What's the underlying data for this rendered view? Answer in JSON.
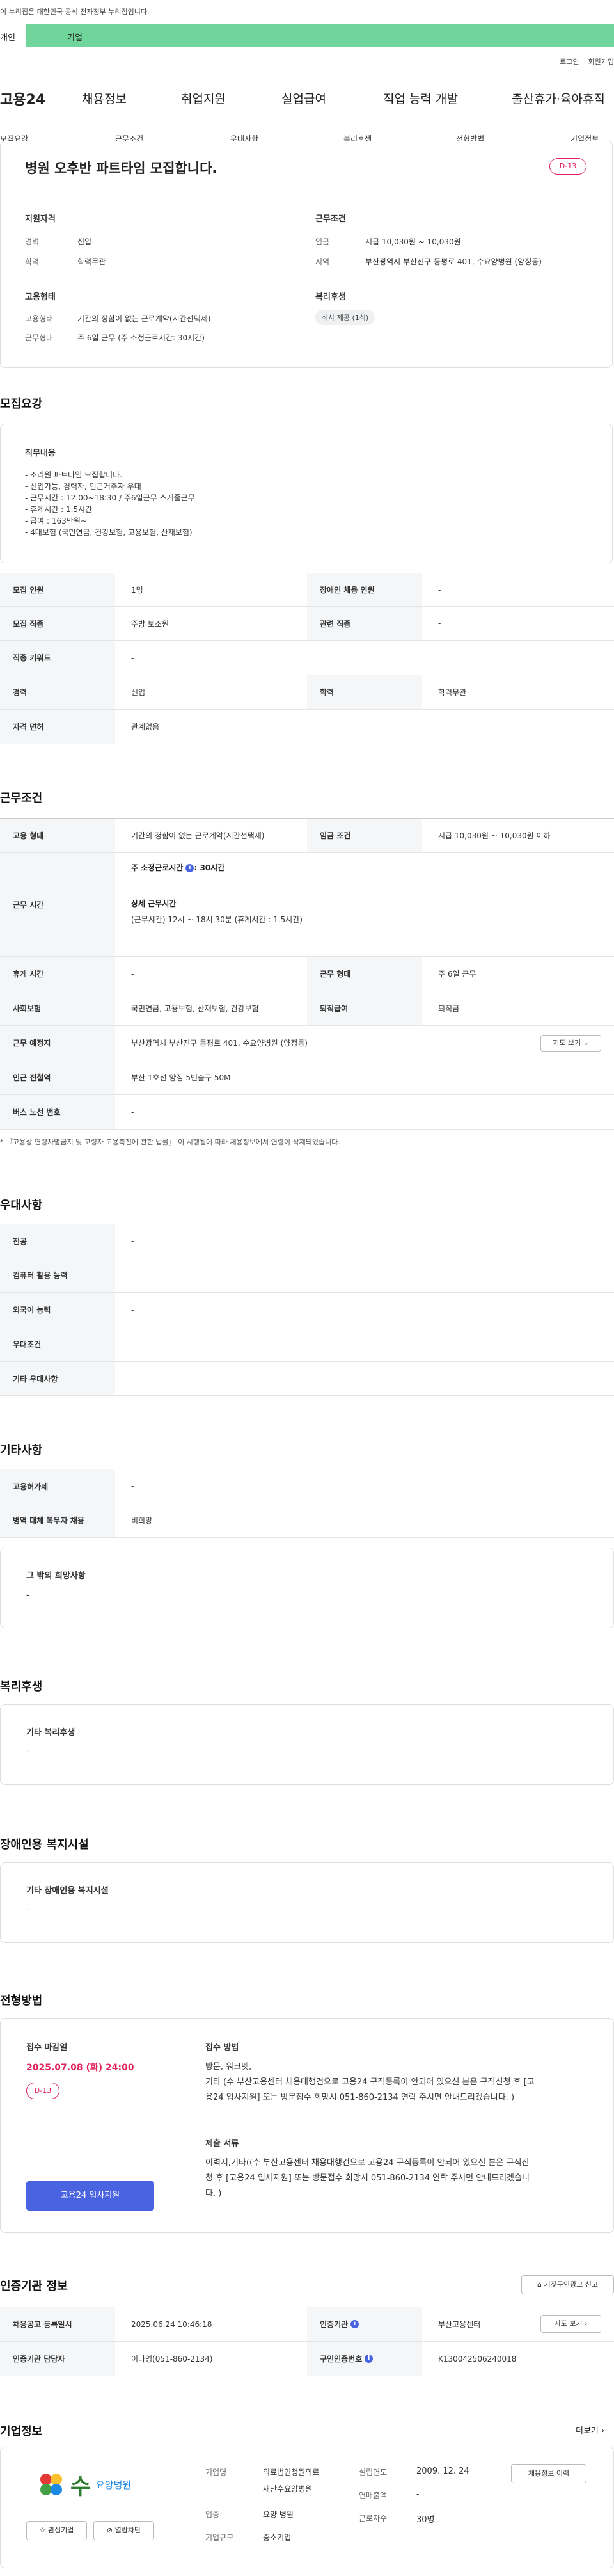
{
  "gov_banner": "이 누리집은 대한민국 공식 전자정부 누리집입니다.",
  "tabs": {
    "personal": "개인",
    "business": "기업"
  },
  "util": {
    "login": "로그인",
    "signup": "회원가입"
  },
  "nav": {
    "logo": "고용24",
    "items": [
      "채용정보",
      "취업지원",
      "실업급여",
      "직업 능력 개발",
      "출산휴가·육아휴직"
    ]
  },
  "subnav": [
    "모집요강",
    "근무조건",
    "우대사항",
    "복리후생",
    "전형방법",
    "기업정보"
  ],
  "summary": {
    "title": "병원 오후반 파트타임 모집합니다.",
    "dday": "D-13",
    "qual_title": "지원자격",
    "career_k": "경력",
    "career_v": "신입",
    "edu_k": "학력",
    "edu_v": "학력무관",
    "cond_title": "근무조건",
    "wage_k": "임금",
    "wage_v": "시급 10,030원 ~ 10,030원",
    "region_k": "지역",
    "region_v": "부산광역시 부산진구 동평로 401, 수요양병원 (양정동)",
    "emp_title": "고용형태",
    "emptype_k": "고용형태",
    "emptype_v": "기간의 정함이 없는 근로계약(시간선택제)",
    "workform_k": "근무형태",
    "workform_v": "주 6일 근무 (주 소정근로시간: 30시간)",
    "welfare_title": "복리후생",
    "welfare_chip": "식사 제공 (1식)"
  },
  "recruit": {
    "section": "모집요강",
    "duty_title": "직무내용",
    "duty_lines": [
      "- 조리원 파트타임 모집합니다.",
      "- 신입가능, 경력자, 인근거주자 우대",
      "- 근무시간 : 12:00~18:30 / 주6일근무 스케줄근무",
      "- 휴게시간 : 1.5시간",
      "- 급여 : 163만원~",
      "- 4대보험 (국민연금, 건강보험, 고용보험, 산재보험)"
    ],
    "rows": [
      {
        "k1": "모집 인원",
        "v1": "1명",
        "k2": "장애인 채용 인원",
        "v2": "-"
      },
      {
        "k1": "모집 직종",
        "v1": "주방 보조원",
        "k2": "관련 직종",
        "v2": "-"
      },
      {
        "k1": "직종 키워드",
        "v1": "-"
      },
      {
        "k1": "경력",
        "v1": "신입",
        "k2": "학력",
        "v2": "학력무관"
      },
      {
        "k1": "자격 면허",
        "v1": "관계없음"
      }
    ]
  },
  "work": {
    "section": "근무조건",
    "r1": {
      "k1": "고용 형태",
      "v1": "기간의 정함이 없는 근로계약(시간선택제)",
      "k2": "임금 조건",
      "v2": "시급 10,030원 ~ 10,030원 이하"
    },
    "hours_k": "근무 시간",
    "hours_line1": "주 소정근로시간",
    "hours_line1_val": ": 30시간",
    "hours_detail_title": "상세 근무시간",
    "hours_detail": "(근무시간) 12시 ~ 18시 30분 (휴게시간 : 1.5시간)",
    "r3": {
      "k1": "휴게 시간",
      "v1": "-",
      "k2": "근무 형태",
      "v2": "주 6일 근무"
    },
    "r4": {
      "k1": "사회보험",
      "v1": "국민연금, 고용보험, 산재보험, 건강보험",
      "k2": "퇴직급여",
      "v2": "퇴직금"
    },
    "r5": {
      "k1": "근무 예정지",
      "v1": "부산광역시 부산진구 동평로 401, 수요양병원 (양정동)",
      "btn": "지도 보기"
    },
    "r6": {
      "k1": "인근 전철역",
      "v1": "부산 1호선 양정 5번출구 50M"
    },
    "r7": {
      "k1": "버스 노선 번호",
      "v1": "-"
    },
    "note": "* 『고용상 연령차별금지 및 고령자 고용촉진에 관한 법률』 이 시행됨에 따라 채용정보에서 연령이 삭제되었습니다."
  },
  "pref": {
    "section": "우대사항",
    "rows": [
      {
        "k": "전공",
        "v": "-"
      },
      {
        "k": "컴퓨터 활용 능력",
        "v": "-"
      },
      {
        "k": "외국어 능력",
        "v": "-"
      },
      {
        "k": "우대조건",
        "v": "-"
      },
      {
        "k": "기타 우대사항",
        "v": "-"
      }
    ]
  },
  "etc": {
    "section": "기타사항",
    "rows": [
      {
        "k": "고용허가제",
        "v": "-"
      },
      {
        "k": "병역 대체 복무자 채용",
        "v": "비희망"
      }
    ],
    "box_title": "그 밖의 희망사항",
    "box_value": "-"
  },
  "welfare": {
    "section": "복리후생",
    "box_title": "기타 복리후생",
    "box_value": "-"
  },
  "disability": {
    "section": "장애인용 복지시설",
    "box_title": "기타 장애인용 복지시설",
    "box_value": "-"
  },
  "selection": {
    "section": "전형방법",
    "deadline_title": "접수 마감일",
    "deadline": "2025.07.08 (화) 24:00",
    "dday": "D-13",
    "apply_btn": "고용24 입사지원",
    "method_title": "접수 방법",
    "method_lines": [
      "방문, 워크넷,",
      "기타 (수 부산고용센터 채용대행건으로  고용24 구직등록이 안되어 있으신 분은 구직신청 후 [고",
      "용24 입사지원] 또는 방문접수 희망시 051-860-2134 연락 주시면 안내드리겠습니다. )"
    ],
    "docs_title": "제출 서류",
    "docs_lines": [
      "이력서,기타((수 부산고용센터 채용대행건으로  고용24 구직등록이 안되어 있으신 분은 구직신",
      "청 후 [고용24 입사지원] 또는 방문접수 희망시 051-860-2134 연락 주시면 안내드리겠습니",
      "다. )"
    ]
  },
  "agency": {
    "section": "인증기관 정보",
    "report_btn": "거짓구인광고 신고",
    "r1": {
      "k1": "채용공고 등록일시",
      "v1": "2025.06.24 10:46:18",
      "k2": "인증기관",
      "v2": "부산고용센터",
      "btn": "지도 보기"
    },
    "r2": {
      "k1": "인증기관 담당자",
      "v1": "이나영(051-860-2134)",
      "k2": "구인인증번호",
      "v2": "K130042506240018"
    }
  },
  "company": {
    "section": "기업정보",
    "more": "더보기",
    "logo_char": "수",
    "logo_name": "요양병원",
    "fav_btn": "관심기업",
    "block_btn": "열람차단",
    "name_k": "기업명",
    "name_v1": "의료법인청원의료",
    "name_v2": "재단수요양병원",
    "ind_k": "업종",
    "ind_v": "요양 병원",
    "scale_k": "기업규모",
    "scale_v": "중소기업",
    "est_k": "설립연도",
    "est_v": "2009. 12. 24",
    "sales_k": "연매출액",
    "sales_v": "-",
    "emp_k": "근로자수",
    "emp_v": "30명",
    "hire_btn": "채용정보 이력"
  }
}
